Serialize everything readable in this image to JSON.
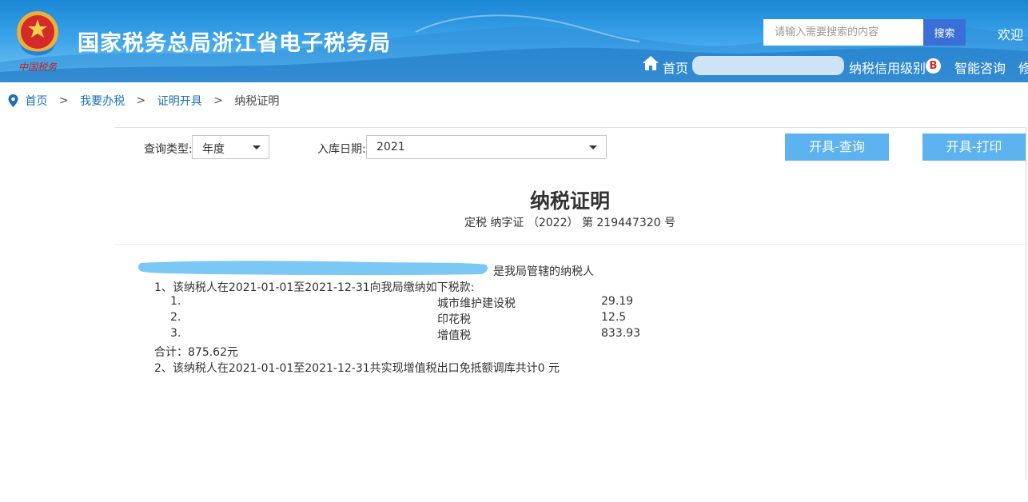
{
  "header": {
    "site_title": "国家税务总局浙江省电子税务局",
    "emblem_caption": "中国税务",
    "search_placeholder": "请输入需要搜索的内容",
    "search_button": "搜索",
    "welcome": "欢迎",
    "nav": {
      "home": "首页",
      "credit_rating": "纳税信用级别",
      "credit_grade": "B",
      "smart_consult": "智能咨询",
      "truncated": "修"
    },
    "colors": {
      "header_top": "#1a86d6",
      "search_button": "#3a6fd8",
      "credit_badge_text": "#d9232e"
    }
  },
  "breadcrumb": {
    "items": [
      "首页",
      "我要办税",
      "证明开具"
    ],
    "current": "纳税证明",
    "separator": ">"
  },
  "query": {
    "type_label": "查询类型:",
    "type_value": "年度",
    "date_label": "入库日期:",
    "date_value": "2021",
    "query_button": "开具-查询",
    "print_button": "开具-打印",
    "button_color": "#5db3ef"
  },
  "certificate": {
    "title": "纳税证明",
    "number": "定税 纳字证 （2022） 第 219447320 号",
    "taxpayer_suffix": "是我局管辖的纳税人",
    "clause1": "1、该纳税人在2021-01-01至2021-12-31向我局缴纳如下税款:",
    "items": [
      {
        "index": "1.",
        "name": "城市维护建设税",
        "amount": "29.19"
      },
      {
        "index": "2.",
        "name": "印花税",
        "amount": "12.5"
      },
      {
        "index": "3.",
        "name": "增值税",
        "amount": "833.93"
      }
    ],
    "total": "合计：875.62元",
    "clause2": "2、该纳税人在2021-01-01至2021-12-31共实现增值税出口免抵额调库共计0 元"
  }
}
